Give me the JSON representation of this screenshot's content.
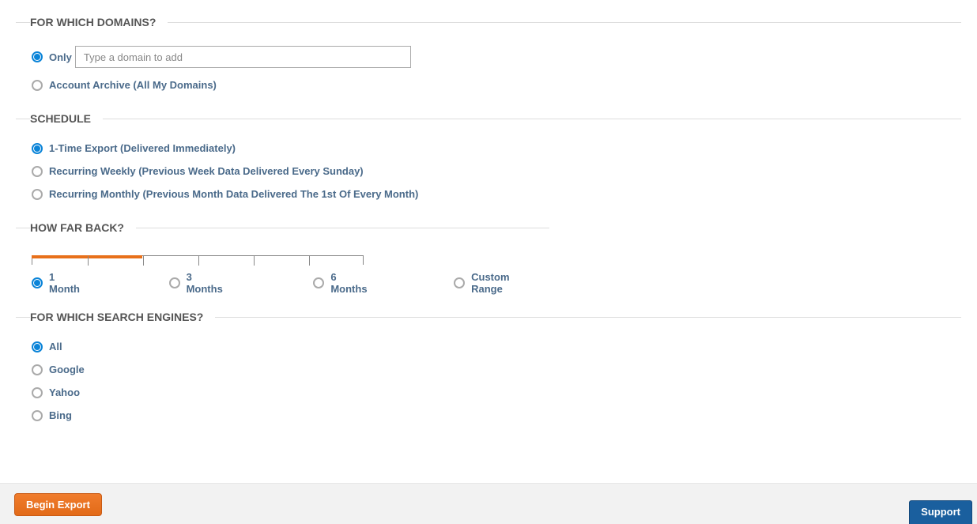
{
  "domains": {
    "legend": "For Which Domains?",
    "only_label": "Only",
    "only_selected": true,
    "domain_input_placeholder": "Type a domain to add",
    "archive_label": "Account Archive (All My Domains)",
    "archive_selected": false
  },
  "schedule": {
    "legend": "Schedule",
    "options": [
      {
        "label": "1-Time Export (Delivered Immediately)",
        "selected": true
      },
      {
        "label": "Recurring Weekly (Previous Week Data Delivered Every Sunday)",
        "selected": false
      },
      {
        "label": "Recurring Monthly (Previous Month Data Delivered The 1st Of Every Month)",
        "selected": false
      }
    ]
  },
  "how_far_back": {
    "legend": "How Far Back?",
    "options": [
      {
        "label": "1 Month",
        "selected": true
      },
      {
        "label": "3 Months",
        "selected": false
      },
      {
        "label": "6 Months",
        "selected": false
      },
      {
        "label": "Custom Range",
        "selected": false
      }
    ]
  },
  "search_engines": {
    "legend": "For Which Search Engines?",
    "options": [
      {
        "label": "All",
        "selected": true
      },
      {
        "label": "Google",
        "selected": false
      },
      {
        "label": "Yahoo",
        "selected": false
      },
      {
        "label": "Bing",
        "selected": false
      }
    ]
  },
  "footer": {
    "begin_export": "Begin Export",
    "support": "Support"
  }
}
